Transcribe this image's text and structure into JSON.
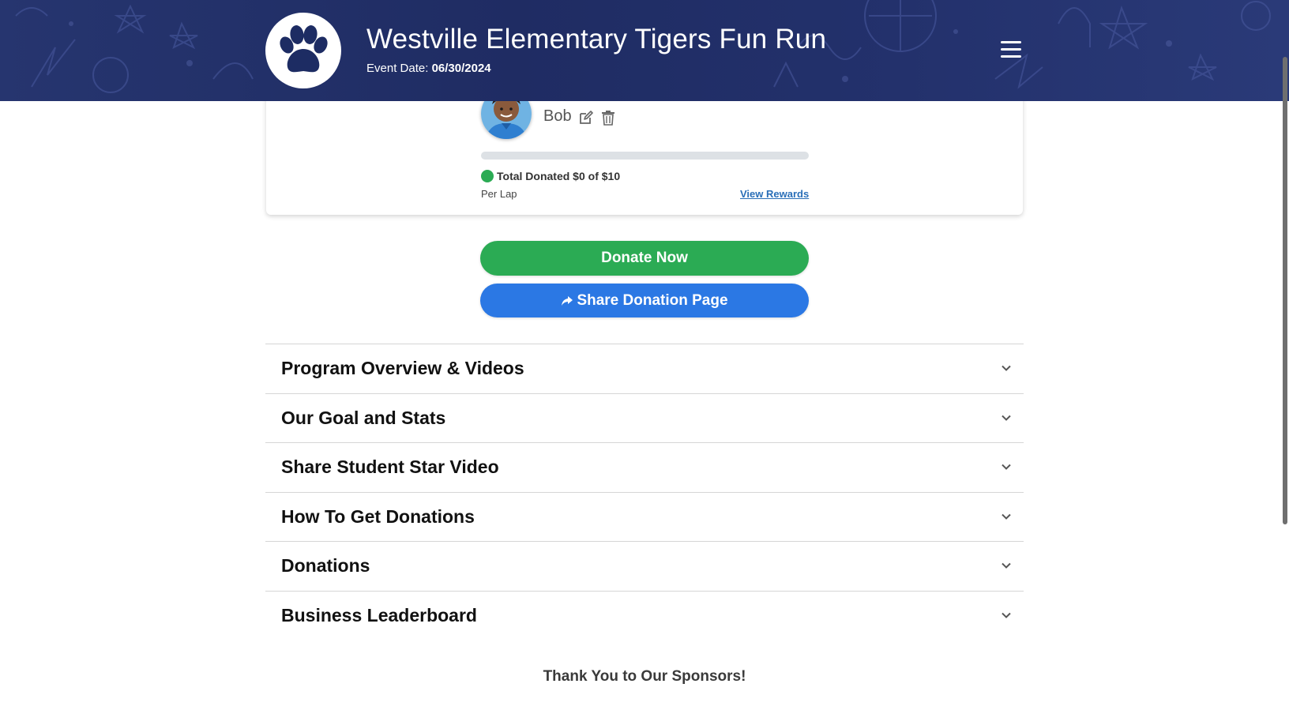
{
  "header": {
    "title": "Westville Elementary Tigers Fun Run",
    "event_date_label": "Event Date:",
    "event_date_value": "06/30/2024",
    "logo_icon": "paw-print-icon",
    "menu_icon": "hamburger-menu-icon",
    "background_color": "#23316c"
  },
  "participant": {
    "name": "Bob",
    "edit_icon": "edit-icon",
    "delete_icon": "trash-icon",
    "progress_fraction": 0,
    "total_donated_text": "Total Donated $0 of $10",
    "per_lap_text": "Per Lap",
    "view_rewards_label": "View Rewards"
  },
  "actions": {
    "donate_label": "Donate Now",
    "share_label": "Share Donation Page",
    "donate_color": "#2bab54",
    "share_color": "#2b78e4"
  },
  "sections": [
    {
      "label": "Program Overview & Videos"
    },
    {
      "label": "Our Goal and Stats"
    },
    {
      "label": "Share Student Star Video"
    },
    {
      "label": "How To Get Donations"
    },
    {
      "label": "Donations"
    },
    {
      "label": "Business Leaderboard"
    }
  ],
  "sponsors_heading": "Thank You to Our Sponsors!"
}
